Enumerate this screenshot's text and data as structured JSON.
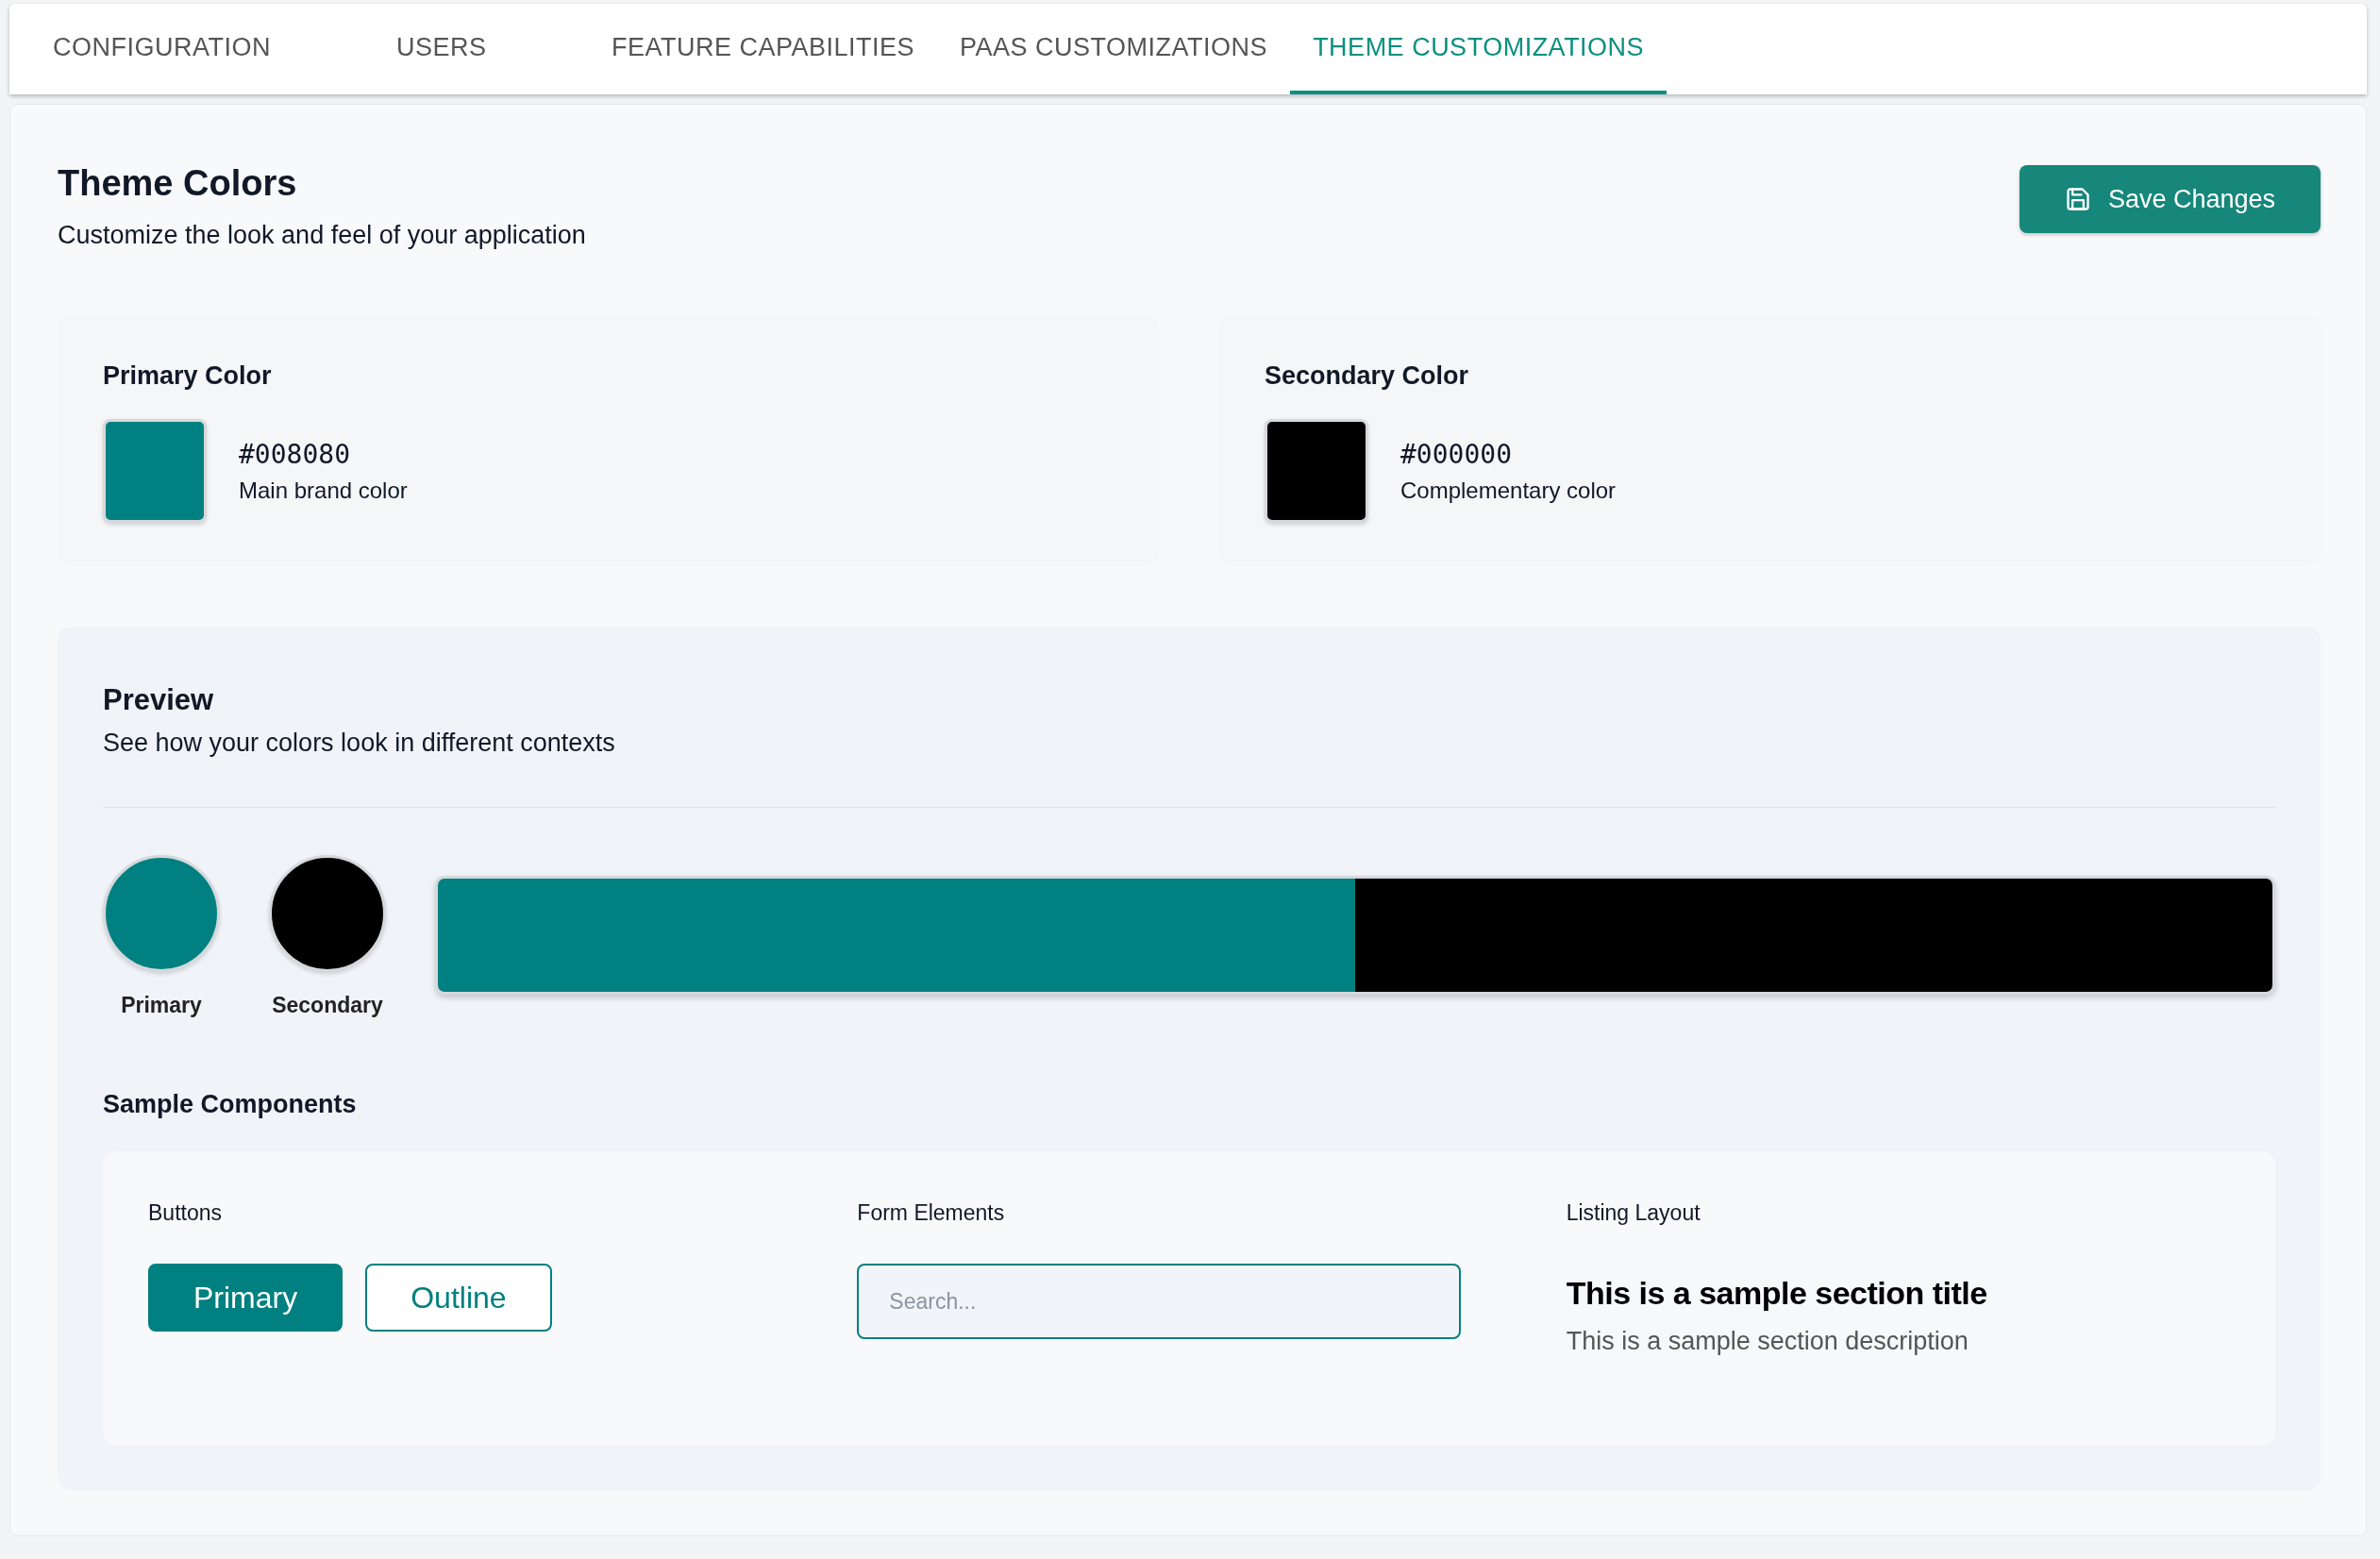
{
  "tabs": [
    {
      "label": "CONFIGURATION",
      "selected": false
    },
    {
      "label": "USERS",
      "selected": false
    },
    {
      "label": "FEATURE CAPABILITIES",
      "selected": false
    },
    {
      "label": "PAAS CUSTOMIZATIONS",
      "selected": false
    },
    {
      "label": "THEME CUSTOMIZATIONS",
      "selected": true
    }
  ],
  "header": {
    "title": "Theme Colors",
    "subtitle": "Customize the look and feel of your application",
    "save_button": "Save Changes"
  },
  "color_cards": [
    {
      "title": "Primary Color",
      "hex": "#008080",
      "description": "Main brand color",
      "color": "#008080"
    },
    {
      "title": "Secondary Color",
      "hex": "#000000",
      "description": "Complementary color",
      "color": "#000000"
    }
  ],
  "preview": {
    "title": "Preview",
    "subtitle": "See how your colors look in different contexts",
    "swatches": [
      {
        "label": "Primary",
        "color": "#008080"
      },
      {
        "label": "Secondary",
        "color": "#000000"
      }
    ],
    "bar_segments": [
      {
        "color": "#008080"
      },
      {
        "color": "#000000"
      }
    ],
    "sample_title": "Sample Components",
    "columns": [
      {
        "kind": "buttons",
        "heading": "Buttons",
        "buttons": [
          {
            "kind": "filled",
            "label": "Primary"
          },
          {
            "kind": "outline",
            "label": "Outline"
          }
        ]
      },
      {
        "kind": "form",
        "heading": "Form Elements",
        "placeholder": "Search..."
      },
      {
        "kind": "listing",
        "heading": "Listing Layout",
        "title": "This is a sample section title",
        "description": "This is a sample section description"
      }
    ]
  }
}
